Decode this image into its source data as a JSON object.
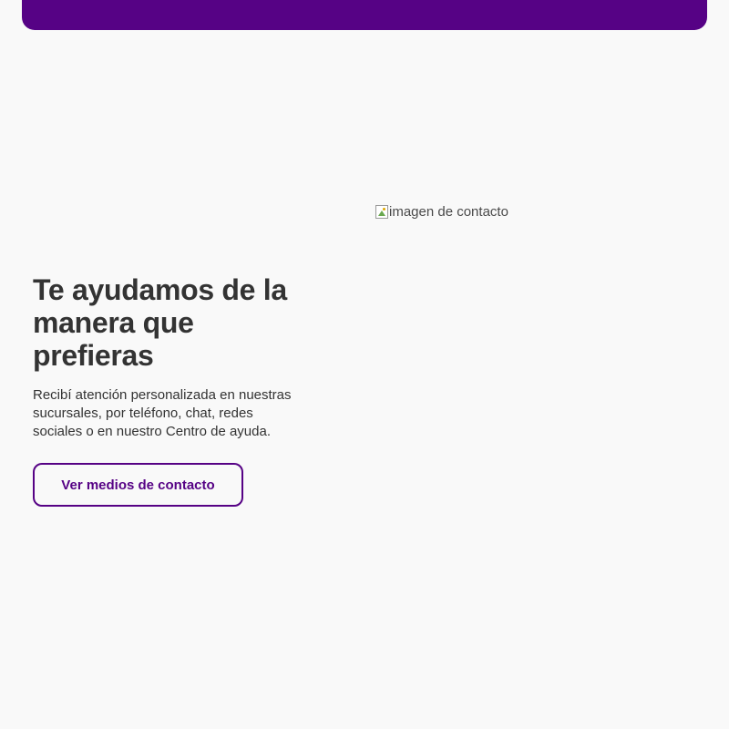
{
  "header": {
    "bar_color": "#560285"
  },
  "hero": {
    "title": "Te ayudamos de la manera que prefieras",
    "description": "Recibí atención personalizada en nuestras sucursales, por teléfono, chat, redes sociales o en nuestro Centro de ayuda.",
    "cta_label": "Ver medios de contacto",
    "image": {
      "alt": "imagen de contacto",
      "icon": "broken-image-icon"
    }
  },
  "colors": {
    "accent": "#560285",
    "text": "#333333",
    "background": "#f9f9f9"
  }
}
